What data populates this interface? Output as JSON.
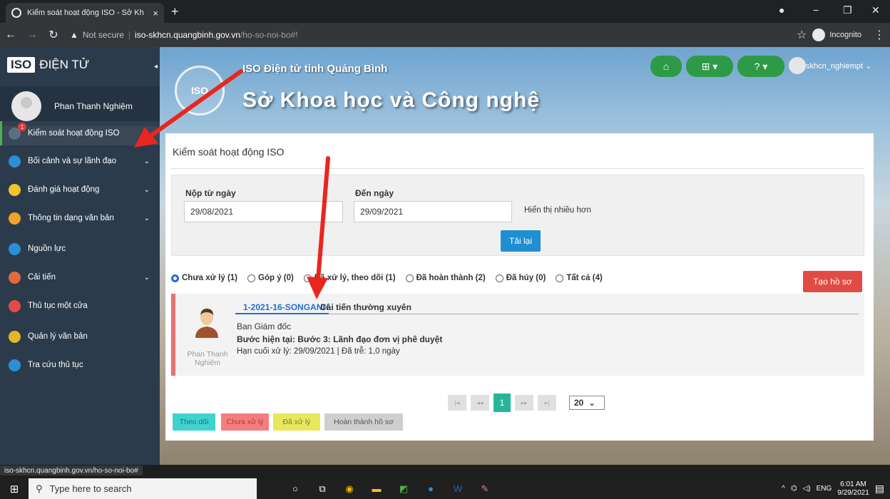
{
  "browser": {
    "tab_title": "Kiểm soát hoạt động ISO - Sở Kh",
    "tab_close": "×",
    "new_tab": "+",
    "not_secure": "Not secure",
    "url_host": "iso-skhcn.quangbinh.gov.vn",
    "url_path": "/ho-so-noi-bo#!",
    "incognito_label": "Incognito",
    "status_url": "iso-skhcn.quangbinh.gov.vn/ho-so-noi-bo#"
  },
  "brand": {
    "iso": "ISO",
    "title": "ĐIỆN TỬ"
  },
  "user": {
    "name": "Phan Thanh Nghiệm",
    "account": "skhcn_nghiempt"
  },
  "header": {
    "subtitle": "ISO Điện tử tỉnh Quảng Bình",
    "title": "Sở Khoa học và Công nghệ",
    "seal_text": "ISO"
  },
  "sidebar": {
    "items": [
      {
        "label": "Kiểm soát hoạt động ISO",
        "badge": "1",
        "color": "#5b6f84",
        "chevron": ""
      },
      {
        "label": "Bối cảnh và sự lãnh đạo",
        "color": "#2a8fd6",
        "chevron": "⌄"
      },
      {
        "label": "Đánh giá hoạt động",
        "color": "#f2c230",
        "chevron": "⌄"
      },
      {
        "label": "Thông tin dạng văn bản",
        "color": "#f0a22a",
        "chevron": "⌄"
      },
      {
        "label": "Nguồn lực",
        "color": "#2a8fd6",
        "chevron": ""
      },
      {
        "label": "Cải tiến",
        "color": "#e36b3b",
        "chevron": "⌄"
      },
      {
        "label": "Thủ tục một cửa",
        "color": "#e34b4b",
        "chevron": ""
      },
      {
        "label": "Quản lý văn bản",
        "color": "#e3b52a",
        "chevron": ""
      },
      {
        "label": "Tra cứu thủ tục",
        "color": "#2a8fd6",
        "chevron": ""
      }
    ]
  },
  "content": {
    "title": "Kiểm soát hoạt động ISO",
    "from_label": "Nộp từ ngày",
    "from_value": "29/08/2021",
    "to_label": "Đến ngày",
    "to_value": "29/09/2021",
    "show_more": "Hiển thị nhiều hơn",
    "reload": "Tải lại",
    "create": "Tạo hồ sơ",
    "filters": [
      {
        "label": "Chưa xử lý (1)",
        "checked": true
      },
      {
        "label": "Góp ý (0)",
        "checked": false
      },
      {
        "label": "Đã xử lý, theo dõi (1)",
        "checked": false
      },
      {
        "label": "Đã hoàn thành (2)",
        "checked": false
      },
      {
        "label": "Đã hủy (0)",
        "checked": false
      },
      {
        "label": "Tất cả (4)",
        "checked": false
      }
    ],
    "record": {
      "code": "1-2021-16-SONGANH",
      "type": "Cải tiến thường xuyên",
      "dept": "Ban Giám đốc",
      "step": "Bước hiện tại: Bước 3: Lãnh đạo đơn vị phê duyệt",
      "due": "Hạn cuối xử lý: 29/09/2021    | Đã trễ: 1,0 ngày",
      "person": "Phan Thanh Nghiệm"
    },
    "pager": {
      "first": "|◂",
      "prev": "◂◂",
      "current": "1",
      "next": "▸▸",
      "last": "▸|",
      "page_size": "20"
    },
    "legend": [
      {
        "label": "Theo dõi",
        "color": "#3fd3d0"
      },
      {
        "label": "Chưa xử lý",
        "color": "#f37e7e"
      },
      {
        "label": "Đã xử lý",
        "color": "#e8e85a"
      },
      {
        "label": "Hoàn thành hồ sơ",
        "color": "#cfcfcf"
      }
    ]
  },
  "taskbar": {
    "search_placeholder": "Type here to search",
    "lang": "ENG",
    "time": "6:01 AM",
    "date": "9/29/2021"
  }
}
